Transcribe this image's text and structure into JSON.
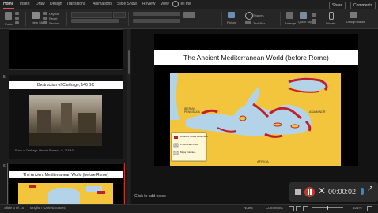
{
  "menu": {
    "items": [
      "Home",
      "Insert",
      "Draw",
      "Design",
      "Transitions",
      "Animations",
      "Slide Show",
      "Review",
      "View"
    ],
    "tell_me": "Tell me",
    "share": "Share",
    "comments": "Comments"
  },
  "ribbon": {
    "paste": "Paste",
    "new_slide": "New\nSlide",
    "layout": "Layout",
    "reset": "Reset",
    "section": "Section",
    "shapes": "Shapes",
    "picture": "Picture",
    "text_box": "Text Box",
    "arrange": "Arrange",
    "quick_styles": "Quick\nStyles",
    "dictate": "Dictate",
    "design_ideas": "Design\nIdeas"
  },
  "thumbnails": [
    {
      "number": "5",
      "title": "Destruction of Carthage, 146 BC",
      "caption": "Ruins of Carthage, Historia Romana, ©, 218 AD"
    },
    {
      "number": "6",
      "title": "The Ancient Mediterranean World (before Rome)"
    }
  ],
  "slide": {
    "title": "The Ancient Mediterranean World (before Rome)",
    "map_labels": {
      "iberia": "IBERIAN\nPENINSULA",
      "africa": "AFRICA",
      "asia": "ASIA MINOR"
    },
    "legend": [
      "Areas of Greek settlement",
      "Phoenician cities",
      "Major colonies"
    ]
  },
  "notes_placeholder": "Click to add notes",
  "status": {
    "slide_count": "Slide 6 of 14",
    "language": "English (United States)",
    "notes": "Notes",
    "comments": "Comments",
    "zoom": "101%"
  },
  "recorder": {
    "time": "00:00:02"
  },
  "colors": {
    "accent": "#d9534f",
    "map_land": "#f2c53d",
    "map_sea": "#b3d4e8",
    "greek": "#c0202a",
    "recorder_red": "#c0392b"
  }
}
